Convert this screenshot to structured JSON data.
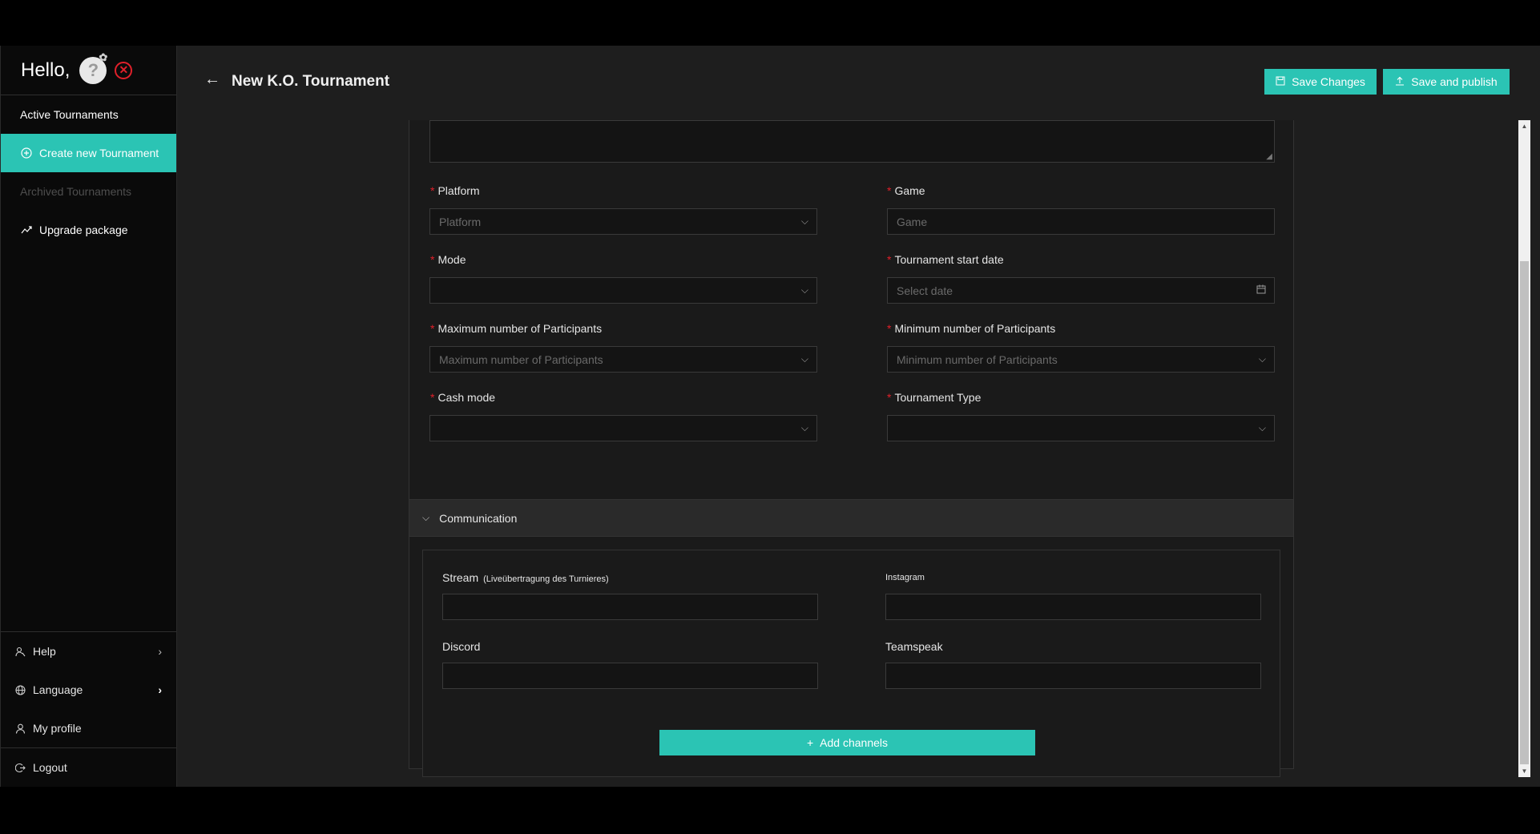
{
  "sidebar": {
    "greeting": "Hello,",
    "avatar_glyph": "?",
    "nav": [
      {
        "label": "Active Tournaments",
        "icon": ""
      },
      {
        "label": "Create new Tournament",
        "icon": "plus-circle-icon"
      },
      {
        "label": "Archived Tournaments",
        "icon": ""
      },
      {
        "label": "Upgrade package",
        "icon": "trend-up-icon"
      }
    ],
    "bottom": [
      {
        "label": "Help",
        "icon": "help-person-icon"
      },
      {
        "label": "Language",
        "icon": "globe-icon"
      },
      {
        "label": "My profile",
        "icon": "user-icon"
      },
      {
        "label": "Logout",
        "icon": "logout-icon"
      }
    ]
  },
  "header": {
    "title": "New K.O. Tournament",
    "save_label": "Save Changes",
    "publish_label": "Save and publish"
  },
  "form": {
    "platform": {
      "label": "Platform",
      "placeholder": "Platform"
    },
    "game": {
      "label": "Game",
      "placeholder": "Game"
    },
    "mode": {
      "label": "Mode",
      "placeholder": ""
    },
    "start_date": {
      "label": "Tournament start date",
      "placeholder": "Select date"
    },
    "max_participants": {
      "label": "Maximum number of Participants",
      "placeholder": "Maximum number of Participants"
    },
    "min_participants": {
      "label": "Minimum number of Participants",
      "placeholder": "Minimum number of Participants"
    },
    "cash_mode": {
      "label": "Cash mode",
      "placeholder": ""
    },
    "tournament_type": {
      "label": "Tournament Type",
      "placeholder": ""
    }
  },
  "communication": {
    "title": "Communication",
    "stream_label": "Stream",
    "stream_hint": "(Liveübertragung des Turnieres)",
    "instagram_label": "Instagram",
    "discord_label": "Discord",
    "teamspeak_label": "Teamspeak",
    "add_channels_label": "Add channels"
  },
  "colors": {
    "accent": "#2bc4b4",
    "required": "#e0202a"
  }
}
